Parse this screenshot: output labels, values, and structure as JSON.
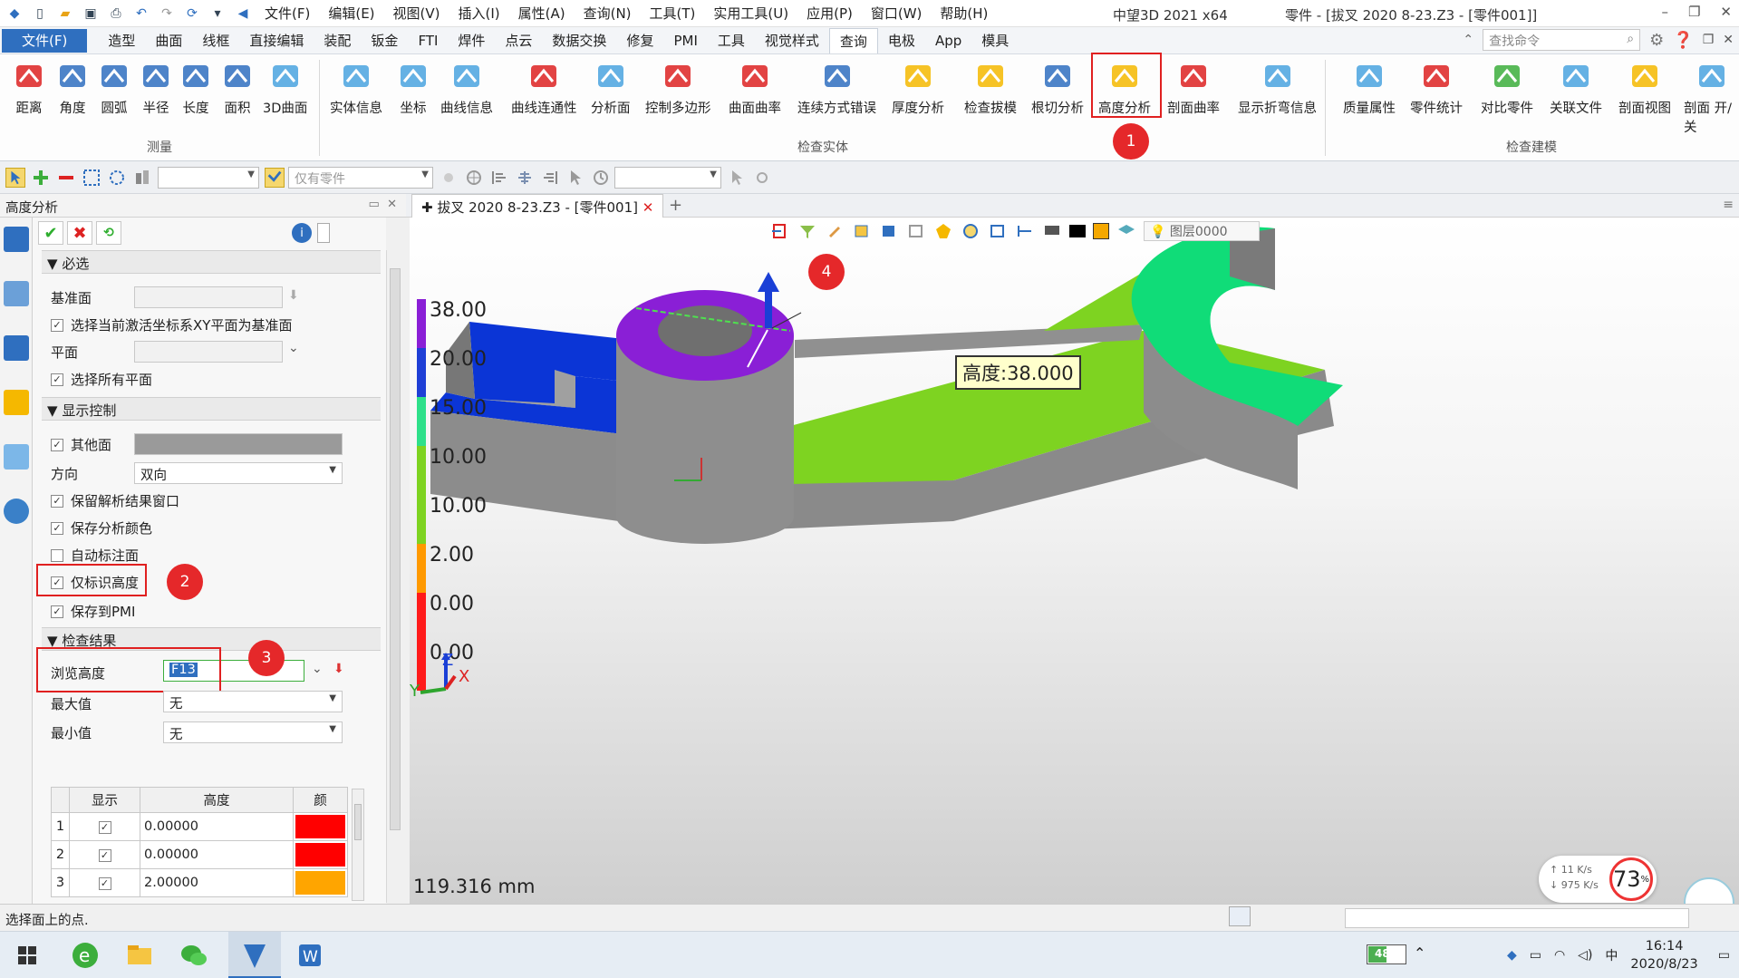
{
  "titlebar": {
    "menu": [
      "文件(F)",
      "编辑(E)",
      "视图(V)",
      "插入(I)",
      "属性(A)",
      "查询(N)",
      "工具(T)",
      "实用工具(U)",
      "应用(P)",
      "窗口(W)",
      "帮助(H)"
    ],
    "app_title": "中望3D 2021 x64",
    "doc_title": "零件 - [拔叉  2020  8-23.Z3 - [零件001]]"
  },
  "tabs": {
    "file": "文件(F)",
    "items": [
      "造型",
      "曲面",
      "线框",
      "直接编辑",
      "装配",
      "钣金",
      "FTI",
      "焊件",
      "点云",
      "数据交换",
      "修复",
      "PMI",
      "工具",
      "视觉样式",
      "查询",
      "电极",
      "App",
      "模具"
    ],
    "active": "查询",
    "search_placeholder": "查找命令"
  },
  "ribbon": {
    "group_measure": "测量",
    "group_inspect_entity": "检查实体",
    "group_inspect_model": "检查建模",
    "measure": [
      "距离",
      "角度",
      "圆弧",
      "半径",
      "长度",
      "面积",
      "3D曲面"
    ],
    "inspect": [
      "实体信息",
      "坐标",
      "曲线信息",
      "曲线连通性",
      "分析面",
      "控制多边形",
      "曲面曲率",
      "连续方式错误",
      "厚度分析",
      "检查拔模",
      "根切分析",
      "高度分析",
      "剖面曲率",
      "显示折弯信息"
    ],
    "model": [
      "质量属性",
      "零件统计",
      "对比零件",
      "关联文件",
      "剖面视图",
      "剖面 开/关"
    ]
  },
  "toolbar2": {
    "filter": "仅有零件"
  },
  "panel": {
    "title": "高度分析",
    "sec_required": "必选",
    "base_face_label": "基准面",
    "use_xy_label": "选择当前激活坐标系XY平面为基准面",
    "plane_label": "平面",
    "select_all_planes_label": "选择所有平面",
    "sec_display": "显示控制",
    "other_face_label": "其他面",
    "direction_label": "方向",
    "direction_value": "双向",
    "keep_window_label": "保留解析结果窗口",
    "save_color_label": "保存分析颜色",
    "auto_annot_label": "自动标注面",
    "only_height_label": "仅标识高度",
    "save_pmi_label": "保存到PMI",
    "sec_result": "检查结果",
    "browse_label": "浏览高度",
    "browse_value": "F13",
    "max_label": "最大值",
    "max_value": "无",
    "min_label": "最小值",
    "min_value": "无",
    "table_headers": [
      "显示",
      "高度",
      "颜"
    ],
    "table_rows": [
      {
        "idx": "1",
        "height": "0.00000",
        "color": "#ff0000"
      },
      {
        "idx": "2",
        "height": "0.00000",
        "color": "#ff0000"
      },
      {
        "idx": "3",
        "height": "2.00000",
        "color": "#ffa500"
      }
    ]
  },
  "doc": {
    "tab_label": "拔叉  2020  8-23.Z3 - [零件001]",
    "layer": "图层0000"
  },
  "legend": {
    "labels": [
      "38.00",
      "20.00",
      "15.00",
      "10.00",
      "10.00",
      "2.00",
      "0.00",
      "0.00"
    ],
    "colors": [
      "#8a1fd6",
      "#1f3fd6",
      "#2ee08a",
      "#7ed321",
      "#7ed321",
      "#ff9900",
      "#ff1a1a",
      "#ff1a1a"
    ]
  },
  "viewport": {
    "tooltip": "高度:38.000",
    "scale": "119.316 mm",
    "axis_x": "X",
    "axis_y": "Y",
    "axis_z": "Z"
  },
  "callouts": [
    "1",
    "2",
    "3",
    "4"
  ],
  "status": {
    "text": "选择面上的点."
  },
  "net": {
    "up": "11 K/s",
    "down": "975 K/s",
    "pct": "73",
    "pct_unit": "%"
  },
  "taskbar": {
    "battery": "48%",
    "battery_level": 0.48,
    "time": "16:14",
    "date": "2020/8/23"
  }
}
